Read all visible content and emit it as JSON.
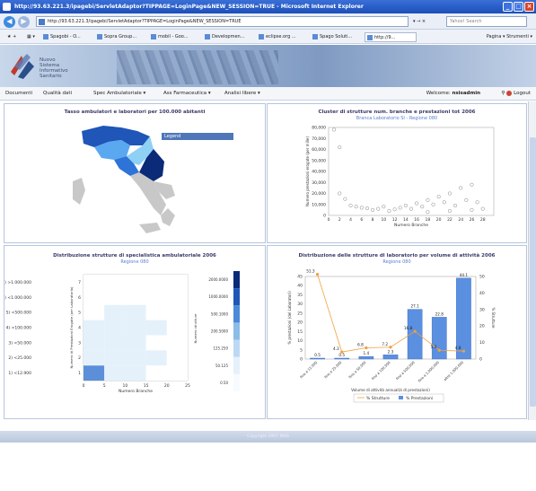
{
  "window": {
    "title": "http://93.63.221.3/ipagebi/ServletAdaptor?TIPPAGE=LoginPage&NEW_SESSION=TRUE - Microsoft Internet Explorer",
    "address": "http://93.63.221.3/ipagebi/ServletAdaptor?TIPPAGE=LoginPage&NEW_SESSION=TRUE",
    "go_label": "▾ → ×",
    "search_placeholder": "Yahoo! Search",
    "tabs": [
      "Spagobi - O...",
      "Sopra Group...",
      "mobil - Goo...",
      "Developmen...",
      "eclipse.org ...",
      "Spago Soluti...",
      "http://9..."
    ],
    "tools_label": "Pagina ▾  Strumenti ▾"
  },
  "brand": {
    "lines": [
      "Nuovo",
      "Sistema",
      "Informativo",
      "Sanitario"
    ]
  },
  "menu": {
    "items": [
      "Documenti",
      "Qualità dati",
      "Spec Ambulatoriale ▾",
      "Ass Farmaceutica ▾",
      "Analisi libere ▾"
    ],
    "welcome_prefix": "Welcome:",
    "username": "nsisadmin",
    "logout_label": "Logout"
  },
  "panels": {
    "map": {
      "title": "Tasso ambulatori e laboratori per 100.000 abitanti",
      "legend_label": "Legend"
    },
    "scatter": {
      "title": "Cluster di strutture num. branche e prestazioni tot 2006",
      "subtitle": "Branca Laboratorio SI - Regione 080"
    },
    "heatmap": {
      "title": "Distribuzione strutture di specialistica ambulatoriale 2006",
      "subtitle": "Regione 080"
    },
    "combo": {
      "title": "Distribuzione delle strutture di laboratorio per volume di attività 2006",
      "subtitle": "Regione 080"
    }
  },
  "footer": {
    "text": "Copyright 2007 NSIS"
  },
  "chart_data": [
    {
      "type": "scatter",
      "title": "Cluster di strutture num. branche e prestazioni tot 2006",
      "subtitle": "Branca Laboratorio SI - Regione 080",
      "xlabel": "Numero Branche",
      "ylabel": "Numero prestazioni erogate (per mille)",
      "xlim": [
        0,
        30
      ],
      "ylim": [
        0,
        80000
      ],
      "x_ticks": [
        "0",
        "2",
        "4",
        "6",
        "8",
        "10",
        "12",
        "14",
        "16",
        "18",
        "20",
        "22",
        "24",
        "26",
        "28"
      ],
      "y_ticks": [
        "0",
        "10,000",
        "20,000",
        "30,000",
        "40,000",
        "50,000",
        "60,000",
        "70,000",
        "80,000"
      ],
      "points": [
        {
          "x": 1,
          "y": 78000
        },
        {
          "x": 2,
          "y": 62000
        },
        {
          "x": 2,
          "y": 20000
        },
        {
          "x": 3,
          "y": 15000
        },
        {
          "x": 4,
          "y": 9000
        },
        {
          "x": 5,
          "y": 8000
        },
        {
          "x": 6,
          "y": 7000
        },
        {
          "x": 7,
          "y": 6500
        },
        {
          "x": 8,
          "y": 5000
        },
        {
          "x": 9,
          "y": 6000
        },
        {
          "x": 10,
          "y": 8000
        },
        {
          "x": 11,
          "y": 4000
        },
        {
          "x": 12,
          "y": 5500
        },
        {
          "x": 13,
          "y": 7000
        },
        {
          "x": 14,
          "y": 9000
        },
        {
          "x": 15,
          "y": 6000
        },
        {
          "x": 16,
          "y": 11000
        },
        {
          "x": 17,
          "y": 8000
        },
        {
          "x": 18,
          "y": 14000
        },
        {
          "x": 19,
          "y": 10000
        },
        {
          "x": 20,
          "y": 17000
        },
        {
          "x": 21,
          "y": 12000
        },
        {
          "x": 22,
          "y": 20000
        },
        {
          "x": 23,
          "y": 9000
        },
        {
          "x": 24,
          "y": 25000
        },
        {
          "x": 25,
          "y": 14000
        },
        {
          "x": 26,
          "y": 28000
        },
        {
          "x": 27,
          "y": 12000
        },
        {
          "x": 28,
          "y": 6000
        },
        {
          "x": 18,
          "y": 3000
        },
        {
          "x": 22,
          "y": 4000
        },
        {
          "x": 26,
          "y": 5000
        }
      ]
    },
    {
      "type": "heatmap",
      "title": "Distribuzione strutture di specialistica ambulatoriale 2006",
      "subtitle": "Regione 080",
      "xlabel": "Numero Branche",
      "ylabel": "Numero di Prestazioni Erogate (per Laboratorio)",
      "x_ticks": [
        "0",
        "5",
        "10",
        "15",
        "20",
        "25"
      ],
      "y_ticks": [
        "1",
        "2",
        "3",
        "4",
        "5",
        "6",
        "7"
      ],
      "y_categories": [
        "1) <12.900",
        "2) <25.000",
        "3) <50.000",
        "4) <100.000",
        "5) <500.000",
        "6) <1.000.000",
        "7) >1.000.000"
      ],
      "legend_title": "Numero strutture",
      "legend_ticks": [
        "2000.0000",
        "1000.0000",
        "500.1000",
        "200.5000",
        "125.250",
        "50.125",
        "0.50"
      ],
      "cells": [
        [
          3,
          1,
          1,
          0,
          0
        ],
        [
          1,
          1,
          1,
          1,
          0
        ],
        [
          1,
          1,
          1,
          0,
          0
        ],
        [
          1,
          1,
          1,
          1,
          0
        ],
        [
          0,
          1,
          1,
          0,
          0
        ],
        [
          0,
          0,
          0,
          0,
          0
        ],
        [
          0,
          0,
          0,
          0,
          0
        ]
      ]
    },
    {
      "type": "bar",
      "title": "Distribuzione delle strutture di laboratorio per volume di attività 2006",
      "subtitle": "Regione 080",
      "xlabel": "Volume di attività annual(à di prestazioni)",
      "ylabel": "% prestazioni (del Laboratori)",
      "y2label": "% Strutture",
      "categories": [
        "fino a 12.000",
        "fino a 25.000",
        "fino a 50.000",
        "fino a 100.000",
        "fino a 500.000",
        "fino a 1.000.000",
        "oltre 1.000.000"
      ],
      "ylim": [
        0,
        45
      ],
      "y_ticks": [
        "0",
        "5",
        "10",
        "15",
        "20",
        "25",
        "30",
        "35",
        "40",
        "45"
      ],
      "y2lim": [
        0,
        50
      ],
      "y2_ticks": [
        "0",
        "10",
        "20",
        "30",
        "40",
        "50"
      ],
      "series": [
        {
          "name": "% Prestazioni",
          "kind": "bar",
          "values": [
            0.5,
            0.5,
            1.4,
            2.3,
            27.1,
            22.8,
            44.1
          ],
          "labels": [
            "0.5",
            "0.5",
            "1.4",
            "2.3",
            "27.1",
            "22.8",
            "44.1"
          ]
        },
        {
          "name": "% Strutture",
          "kind": "line",
          "values": [
            51.3,
            4.3,
            6.8,
            7.2,
            16.8,
            5.3,
            4.8
          ],
          "labels": [
            "51.3",
            "4.3",
            "6.8",
            "7.2",
            "16.8",
            "5.3",
            "4.8"
          ]
        }
      ],
      "legend": [
        "% Strutture",
        "% Prestazioni"
      ]
    }
  ]
}
